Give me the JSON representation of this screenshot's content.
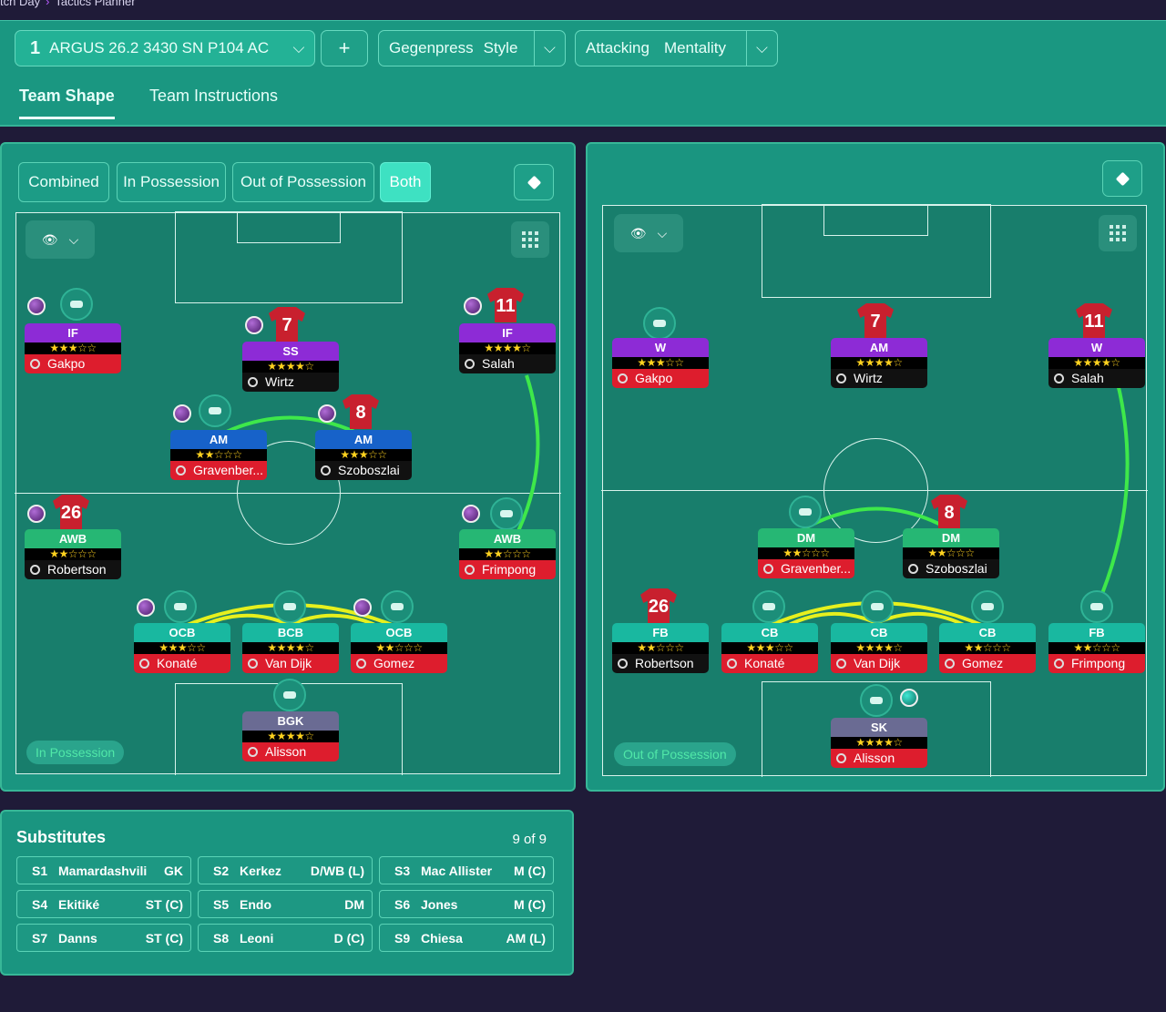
{
  "breadcrumb": {
    "first": "tch Day",
    "second": "Tactics Planner"
  },
  "header": {
    "tactic_num": "1",
    "tactic_name": "ARGUS 26.2 3430 SN P104 AC",
    "add_label": "+",
    "style_value": "Gegenpress",
    "style_label": "Style",
    "mentality_value": "Attacking",
    "mentality_label": "Mentality",
    "tabs": [
      "Team Shape",
      "Team Instructions"
    ]
  },
  "view_buttons": [
    "Combined",
    "In Possession",
    "Out of Possession",
    "Both"
  ],
  "left_chip": "In Possession",
  "right_chip": "Out of Possession",
  "in_possession": [
    {
      "role": "IF",
      "stars": "★★★☆☆",
      "name": "Gakpo",
      "shirt": ""
    },
    {
      "role": "SS",
      "stars": "★★★★☆",
      "name": "Wirtz",
      "shirt": "7"
    },
    {
      "role": "IF",
      "stars": "★★★★☆",
      "name": "Salah",
      "shirt": "11"
    },
    {
      "role": "AM",
      "stars": "★★☆☆☆",
      "name": "Gravenber...",
      "shirt": ""
    },
    {
      "role": "AM",
      "stars": "★★★☆☆",
      "name": "Szoboszlai",
      "shirt": "8"
    },
    {
      "role": "AWB",
      "stars": "★★☆☆☆",
      "name": "Robertson",
      "shirt": "26"
    },
    {
      "role": "AWB",
      "stars": "★★☆☆☆",
      "name": "Frimpong",
      "shirt": ""
    },
    {
      "role": "OCB",
      "stars": "★★★☆☆",
      "name": "Konaté",
      "shirt": ""
    },
    {
      "role": "BCB",
      "stars": "★★★★☆",
      "name": "Van Dijk",
      "shirt": ""
    },
    {
      "role": "OCB",
      "stars": "★★☆☆☆",
      "name": "Gomez",
      "shirt": ""
    },
    {
      "role": "BGK",
      "stars": "★★★★☆",
      "name": "Alisson",
      "shirt": ""
    }
  ],
  "out_possession": [
    {
      "role": "W",
      "stars": "★★★☆☆",
      "name": "Gakpo",
      "shirt": ""
    },
    {
      "role": "AM",
      "stars": "★★★★☆",
      "name": "Wirtz",
      "shirt": "7"
    },
    {
      "role": "W",
      "stars": "★★★★☆",
      "name": "Salah",
      "shirt": "11"
    },
    {
      "role": "DM",
      "stars": "★★☆☆☆",
      "name": "Gravenber...",
      "shirt": ""
    },
    {
      "role": "DM",
      "stars": "★★☆☆☆",
      "name": "Szoboszlai",
      "shirt": "8"
    },
    {
      "role": "FB",
      "stars": "★★☆☆☆",
      "name": "Robertson",
      "shirt": "26"
    },
    {
      "role": "CB",
      "stars": "★★★☆☆",
      "name": "Konaté",
      "shirt": ""
    },
    {
      "role": "CB",
      "stars": "★★★★☆",
      "name": "Van Dijk",
      "shirt": ""
    },
    {
      "role": "CB",
      "stars": "★★☆☆☆",
      "name": "Gomez",
      "shirt": ""
    },
    {
      "role": "FB",
      "stars": "★★☆☆☆",
      "name": "Frimpong",
      "shirt": ""
    },
    {
      "role": "SK",
      "stars": "★★★★☆",
      "name": "Alisson",
      "shirt": ""
    }
  ],
  "substitutes": {
    "title": "Substitutes",
    "count": "9 of 9",
    "items": [
      {
        "slot": "S1",
        "name": "Mamardashvili",
        "pos": "GK"
      },
      {
        "slot": "S2",
        "name": "Kerkez",
        "pos": "D/WB (L)"
      },
      {
        "slot": "S3",
        "name": "Mac Allister",
        "pos": "M (C)"
      },
      {
        "slot": "S4",
        "name": "Ekitiké",
        "pos": "ST (C)"
      },
      {
        "slot": "S5",
        "name": "Endo",
        "pos": "DM"
      },
      {
        "slot": "S6",
        "name": "Jones",
        "pos": "M (C)"
      },
      {
        "slot": "S7",
        "name": "Danns",
        "pos": "ST (C)"
      },
      {
        "slot": "S8",
        "name": "Leoni",
        "pos": "D (C)"
      },
      {
        "slot": "S9",
        "name": "Chiesa",
        "pos": "AM (L)"
      }
    ]
  },
  "colors": {
    "panel": "#1a9580",
    "pitch": "#187e6c",
    "accent": "#3ee1c2",
    "link_green": "#3ee84a",
    "link_yellow": "#e6f01e"
  }
}
